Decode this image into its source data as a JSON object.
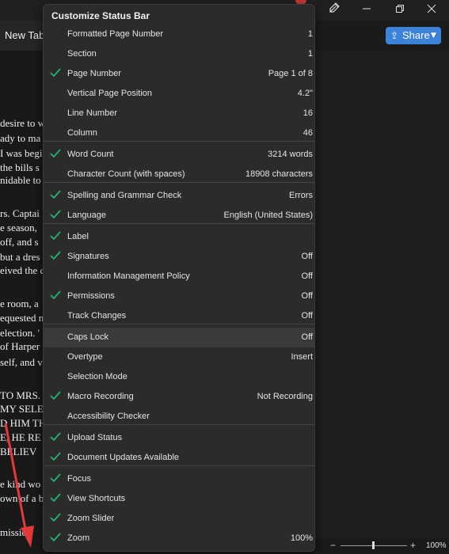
{
  "window": {
    "tab_label": "New Tab",
    "share_label": "Share",
    "zoom_percent": "100%",
    "colors": {
      "accent": "#3b82d8",
      "check": "#22b573",
      "arrow": "#e3393b",
      "menu_bg": "#2b2b2b"
    }
  },
  "document": {
    "lines": [
      "desire to w",
      "ady to ma",
      "I was begi",
      "the bills s",
      "nidable to",
      "rs. Captai",
      "e season,",
      "off, and s",
      "but a dres",
      "eived the c",
      "e room, a",
      "equested n",
      "election. '",
      "of Harper",
      "self, and v",
      "TO MRS.",
      "MY SELE",
      "D HIM TH",
      "E, HE RE",
      "BELIEV",
      "e kind wo",
      "own of a b",
      "missio"
    ]
  },
  "menu": {
    "title": "Customize Status Bar",
    "items": [
      {
        "label": "Formatted Page Number",
        "value": "1",
        "checked": false
      },
      {
        "label": "Section",
        "value": "1",
        "checked": false
      },
      {
        "label": "Page Number",
        "value": "Page 1 of 8",
        "checked": true
      },
      {
        "label": "Vertical Page Position",
        "value": "4.2\"",
        "checked": false
      },
      {
        "label": "Line Number",
        "value": "16",
        "checked": false
      },
      {
        "label": "Column",
        "value": "46",
        "checked": false
      },
      {
        "label": "Word Count",
        "value": "3214 words",
        "checked": true
      },
      {
        "label": "Character Count (with spaces)",
        "value": "18908 characters",
        "checked": false
      },
      {
        "label": "Spelling and Grammar Check",
        "value": "Errors",
        "checked": true
      },
      {
        "label": "Language",
        "value": "English (United States)",
        "checked": true
      },
      {
        "label": "Label",
        "value": "",
        "checked": true
      },
      {
        "label": "Signatures",
        "value": "Off",
        "checked": true
      },
      {
        "label": "Information Management Policy",
        "value": "Off",
        "checked": false
      },
      {
        "label": "Permissions",
        "value": "Off",
        "checked": true
      },
      {
        "label": "Track Changes",
        "value": "Off",
        "checked": false
      },
      {
        "label": "Caps Lock",
        "value": "Off",
        "checked": false,
        "highlighted": true
      },
      {
        "label": "Overtype",
        "value": "Insert",
        "checked": false
      },
      {
        "label": "Selection Mode",
        "value": "",
        "checked": false
      },
      {
        "label": "Macro Recording",
        "value": "Not Recording",
        "checked": true
      },
      {
        "label": "Accessibility Checker",
        "value": "",
        "checked": false
      },
      {
        "label": "Upload Status",
        "value": "",
        "checked": true
      },
      {
        "label": "Document Updates Available",
        "value": "",
        "checked": true
      },
      {
        "label": "Focus",
        "value": "",
        "checked": true
      },
      {
        "label": "View Shortcuts",
        "value": "",
        "checked": true
      },
      {
        "label": "Zoom Slider",
        "value": "",
        "checked": true
      },
      {
        "label": "Zoom",
        "value": "100%",
        "checked": true
      }
    ]
  }
}
